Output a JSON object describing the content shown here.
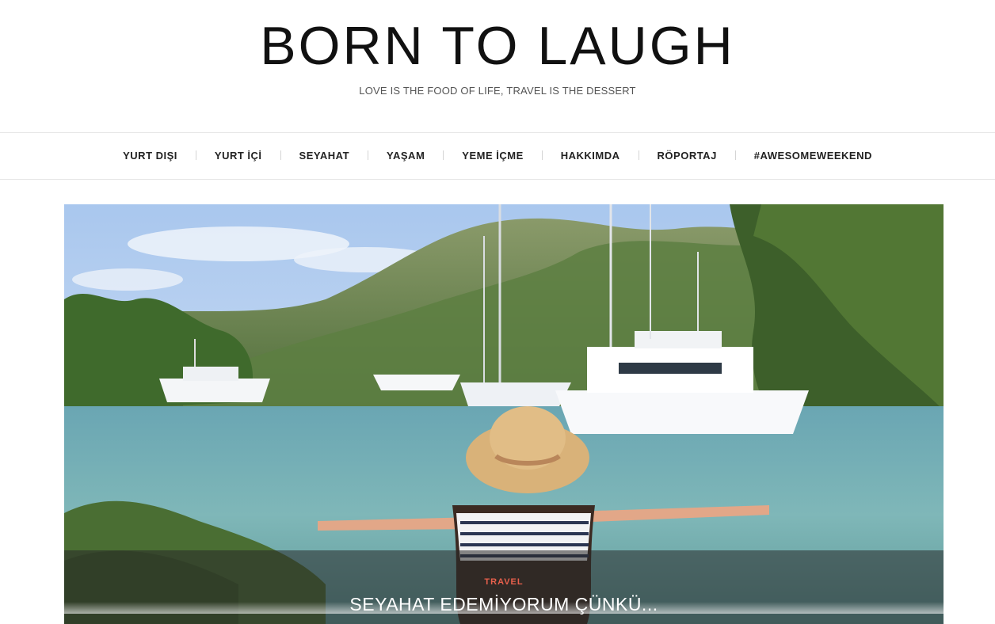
{
  "site": {
    "title": "BORN TO LAUGH",
    "tagline": "LOVE IS THE FOOD OF LIFE, TRAVEL IS THE DESSERT"
  },
  "nav": {
    "items": [
      {
        "label": "YURT DIŞI"
      },
      {
        "label": "YURT İÇİ"
      },
      {
        "label": "SEYAHAT"
      },
      {
        "label": "YAŞAM"
      },
      {
        "label": "YEME İÇME"
      },
      {
        "label": "HAKKIMDA"
      },
      {
        "label": "RÖPORTAJ"
      },
      {
        "label": "#AWESOMEWEEKEND"
      }
    ]
  },
  "featured": {
    "category": "TRAVEL",
    "title": "SEYAHAT EDEMİYORUM ÇÜNKÜ...",
    "image_icon": "photo-bay-boats-woman-hat"
  },
  "colors": {
    "category_accent": "#e8604c",
    "title_text": "#111111"
  }
}
